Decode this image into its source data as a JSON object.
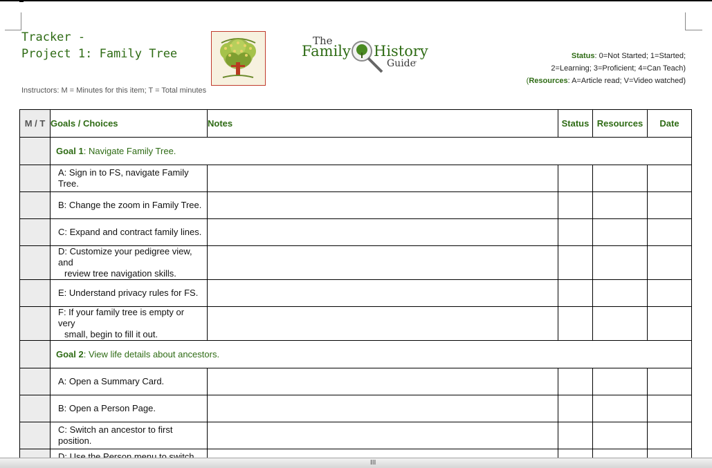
{
  "header": {
    "title_line1": "Tracker -",
    "title_line2": "Project 1: Family Tree",
    "instructors": "Instructors: M = Minutes for this item; T = Total minutes"
  },
  "logo": {
    "the": "The",
    "family": "Family",
    "history": "History",
    "guide": "Guide",
    "tm": "™"
  },
  "legend": {
    "status_label": "Status",
    "status_text1": ": 0=Not Started; 1=Started;",
    "status_text2": "2=Learning; 3=Proficient; 4=Can Teach)",
    "resources_open": "(",
    "resources_label": "Resources",
    "resources_text": ": A=Article read; V=Video watched)"
  },
  "table": {
    "headers": {
      "mt": "M / T",
      "goals": "Goals / Choices",
      "notes": "Notes",
      "status": "Status",
      "resources": "Resources",
      "date": "Date"
    },
    "goal1": {
      "label": "Goal 1",
      "text": ": Navigate Family Tree."
    },
    "goal1_items": [
      {
        "line1": "A: Sign in to FS, navigate Family Tree."
      },
      {
        "line1": "B: Change the zoom in Family Tree."
      },
      {
        "line1": "C: Expand and contract family lines."
      },
      {
        "line1": "D: Customize your pedigree view, and",
        "line2": "review tree navigation skills."
      },
      {
        "line1": "E: Understand privacy rules for FS."
      },
      {
        "line1": "F: If your family tree is empty or very",
        "line2": "small, begin to fill it out."
      }
    ],
    "goal2": {
      "label": "Goal 2",
      "text": ": View life details about ancestors."
    },
    "goal2_items": [
      {
        "line1": "A: Open a Summary Card."
      },
      {
        "line1": "B: Open a Person Page."
      },
      {
        "line1": "C: Switch an ancestor to first position."
      },
      {
        "line1": "D: Use the Person menu to switch to"
      }
    ]
  },
  "statusbar": {
    "grip": "III"
  },
  "colors": {
    "accent_green": "#2e6b14",
    "shade": "#ececec"
  }
}
